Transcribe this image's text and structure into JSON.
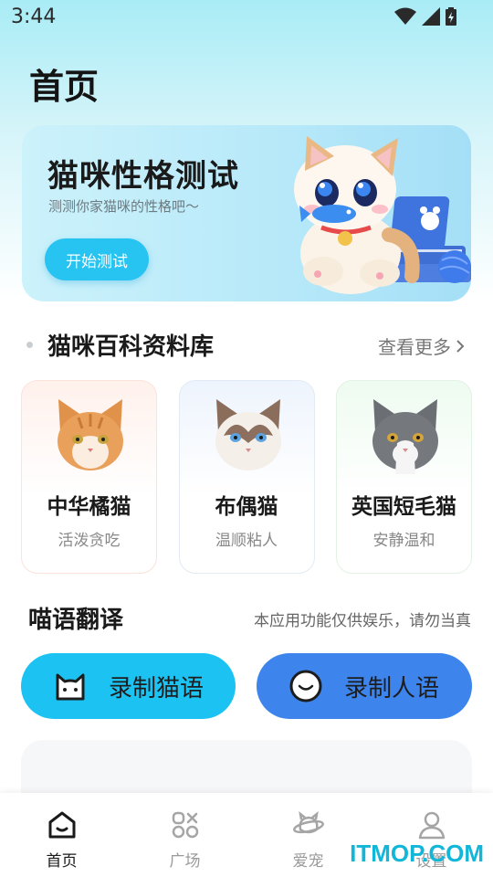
{
  "status_bar": {
    "time": "3:44",
    "icons": [
      "wifi-icon",
      "signal-icon",
      "battery-icon"
    ]
  },
  "page": {
    "title": "首页"
  },
  "banner": {
    "title": "猫咪性格测试",
    "subtitle": "测测你家猫咪的性格吧～",
    "button_label": "开始测试"
  },
  "encyclopedia": {
    "title": "猫咪百科资料库",
    "see_more": "查看更多",
    "cats": [
      {
        "name": "中华橘猫",
        "desc": "活泼贪吃"
      },
      {
        "name": "布偶猫",
        "desc": "温顺粘人"
      },
      {
        "name": "英国短毛猫",
        "desc": "安静温和"
      }
    ]
  },
  "translate": {
    "title": "喵语翻译",
    "note": "本应用功能仅供娱乐，请勿当真",
    "record_cat": "录制猫语",
    "record_human": "录制人语"
  },
  "tabs": [
    {
      "label": "首页",
      "icon": "home-icon"
    },
    {
      "label": "广场",
      "icon": "square-grid-icon"
    },
    {
      "label": "爱宠",
      "icon": "pet-planet-icon"
    },
    {
      "label": "设置",
      "icon": "user-icon"
    }
  ],
  "watermark": "ITMOP.COM",
  "colors": {
    "accent": "#27c3f1",
    "cat_button": "#1cc3f2",
    "human_button": "#3d85ec"
  }
}
